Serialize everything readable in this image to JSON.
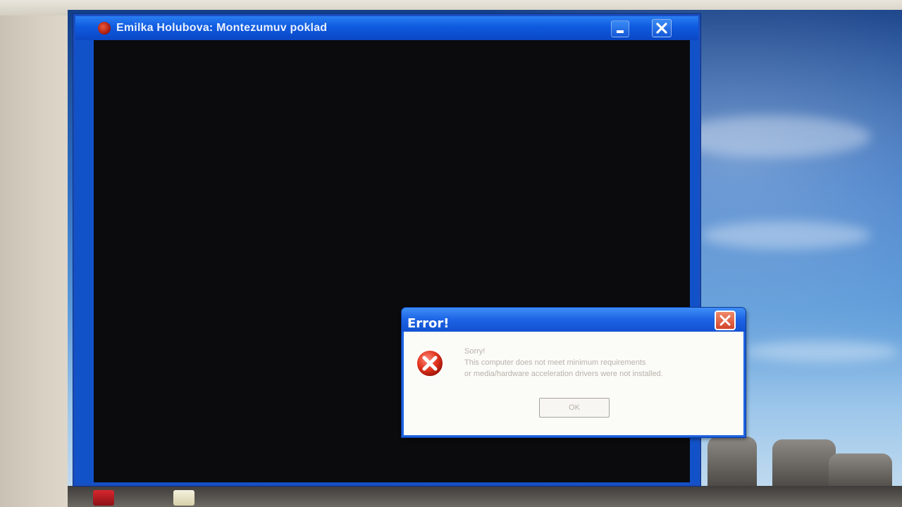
{
  "game_window": {
    "title": "Emilka Holubova: Montezumuv poklad",
    "icon": "app-icon",
    "controls": [
      "minimize-icon",
      "close-icon"
    ]
  },
  "error_dialog": {
    "title": "Error!",
    "icon": "error-x-icon",
    "message_line1": "Sorry!",
    "message_line2": "This computer does not meet minimum requirements",
    "message_line3": "or media/hardware acceleration drivers were not installed.",
    "ok_label": "OK",
    "close_icon": "close-icon"
  }
}
